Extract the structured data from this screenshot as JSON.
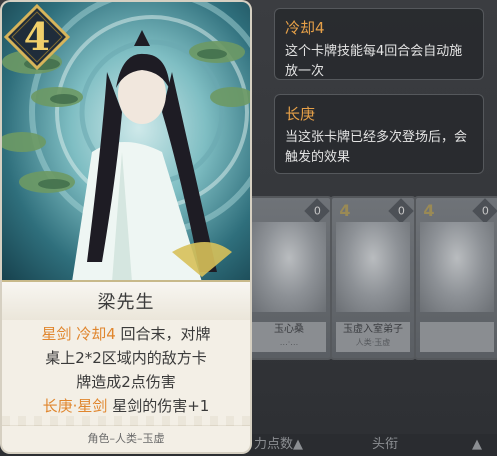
{
  "card": {
    "cost": "4",
    "name": "梁先生",
    "desc_line1_kw1": "星剑",
    "desc_line1_kw2": "冷却4",
    "desc_line1_rest": " 回合末，对牌",
    "desc_line2": "桌上2*2区域内的敌方卡",
    "desc_line3": "牌造成2点伤害",
    "desc_line4_kw": "长庚·星剑",
    "desc_line4_rest": " 星剑的伤害+1",
    "footer": "角色–人类–玉虚"
  },
  "tooltips": [
    {
      "title": "冷却4",
      "body": "这个卡牌技能每4回合会自动施放一次"
    },
    {
      "title": "长庚",
      "body": "当这张卡牌已经多次登场后，会触发的效果"
    }
  ],
  "background_cards": [
    {
      "cost_left": "",
      "cost_right": "0",
      "name": "玉心桑",
      "sub": "…·…"
    },
    {
      "cost_left": "4",
      "cost_right": "0",
      "name": "玉虚入室弟子",
      "sub": "人类·玉虚"
    },
    {
      "cost_left": "4",
      "cost_right": "0",
      "name": "",
      "sub": ""
    }
  ],
  "sort_bar": {
    "item1": "力点数▲",
    "item2": "头衔",
    "item3": "▲"
  },
  "colors": {
    "keyword": "#e0862e",
    "tooltip_title": "#e6a048",
    "cost_gold": "#f0cf6a"
  }
}
